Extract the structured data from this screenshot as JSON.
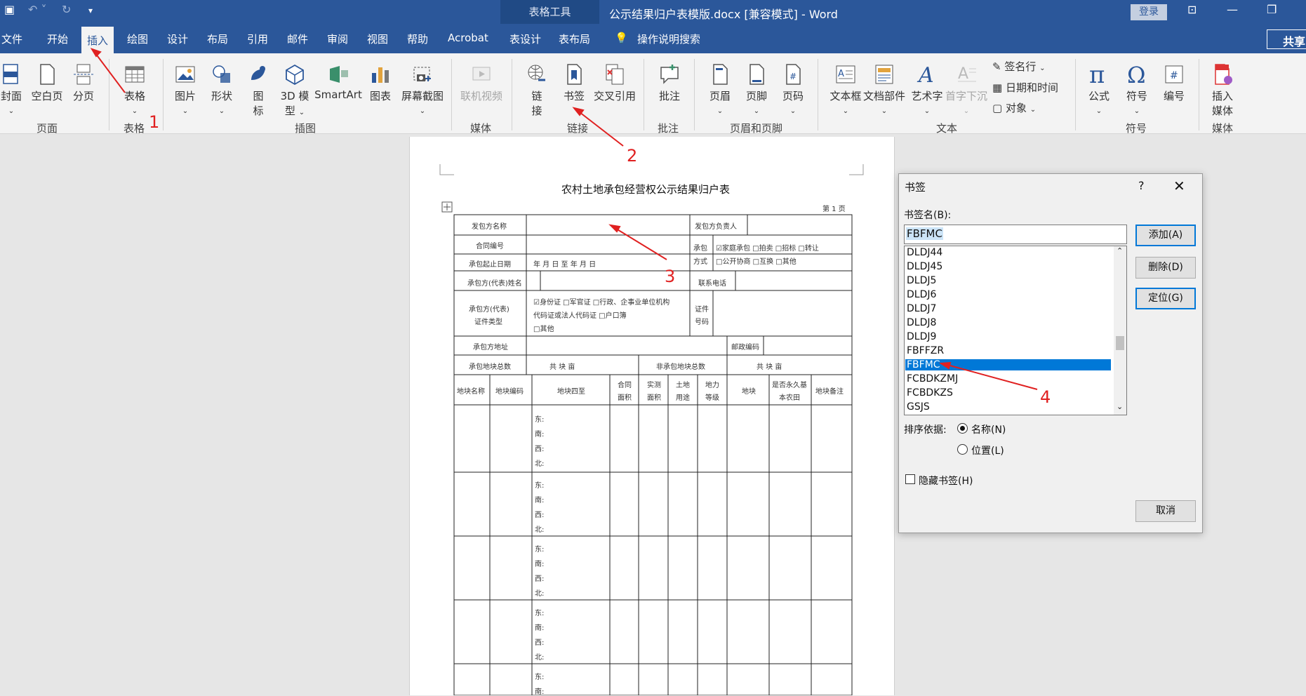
{
  "titlebar": {
    "context_label": "表格工具",
    "doc_title": "公示结果归户表模版.docx [兼容模式] - Word",
    "login": "登录"
  },
  "tabs": [
    "文件",
    "开始",
    "插入",
    "绘图",
    "设计",
    "布局",
    "引用",
    "邮件",
    "审阅",
    "视图",
    "帮助",
    "Acrobat",
    "表设计",
    "表布局"
  ],
  "active_tab": "插入",
  "tell_me": "操作说明搜索",
  "share": "共享",
  "ribbon": {
    "buttons": {
      "cover": "封面",
      "blank_page": "空白页",
      "page_break": "分页",
      "table": "表格",
      "pictures": "图片",
      "shapes": "形状",
      "icons_1": "图",
      "icons_2": "标",
      "model3d_1": "3D 模",
      "model3d_2": "型",
      "smartart": "SmartArt",
      "chart": "图表",
      "screenshot": "屏幕截图",
      "online_video": "联机视频",
      "link_1": "链",
      "link_2": "接",
      "bookmark": "书签",
      "cross_ref": "交叉引用",
      "comment": "批注",
      "header": "页眉",
      "footer": "页脚",
      "page_number": "页码",
      "text_box": "文本框",
      "quick_parts": "文档部件",
      "wordart": "艺术字",
      "drop_cap": "首字下沉",
      "signature_line": "签名行",
      "date_time": "日期和时间",
      "object": "对象",
      "equation": "公式",
      "symbol": "符号",
      "numbering": "编号",
      "insert_media_1": "插入",
      "insert_media_2": "媒体"
    },
    "groups": {
      "pages": "页面",
      "tables": "表格",
      "illustrations": "插图",
      "media": "媒体",
      "links": "链接",
      "comments": "批注",
      "header_footer": "页眉和页脚",
      "text": "文本",
      "symbols": "符号",
      "media2": "媒体"
    }
  },
  "document": {
    "title": "农村土地承包经营权公示结果归户表",
    "page_no": "第 1 页",
    "labels": {
      "fbf_name": "发包方名称",
      "fbf_head": "发包方负责人",
      "contract_no": "合同编号",
      "contract_mode_1": "承包",
      "contract_mode_2": "方式",
      "mode_opts_1": "☑家庭承包 □拍卖 □招标 □转让",
      "mode_opts_2": "□公开协商 □互换 □其他",
      "period": "承包起止日期",
      "period_value": "年    月    日 至      年    月    日",
      "cbf_name": "承包方(代表)姓名",
      "phone": "联系电话",
      "id_type_1": "承包方(代表)",
      "id_type_2": "证件类型",
      "id_opts_1": "☑身份证 □军官证 □行政、企事业单位机构",
      "id_opts_2": "代码证或法人代码证 □户口簿",
      "id_opts_3": "□其他",
      "id_no_1": "证件",
      "id_no_2": "号码",
      "address": "承包方地址",
      "postcode": "邮政编码",
      "total_plots": "承包地块总数",
      "total_value": "共    块    亩",
      "non_plots": "非承包地块总数",
      "non_value": "共    块    亩",
      "col_plot_name": "地块名称",
      "col_plot_code": "地块编码",
      "col_bounds": "地块四至",
      "col_contract_area_1": "合同",
      "col_contract_area_2": "面积",
      "col_real_area_1": "实测",
      "col_real_area_2": "面积",
      "col_land_use_1": "土地",
      "col_land_use_2": "用途",
      "col_grade_1": "地力",
      "col_grade_2": "等级",
      "col_type": "地块",
      "col_basic_1": "是否永久基",
      "col_basic_2": "本农田",
      "col_note": "地块备注",
      "dir_e": "东:",
      "dir_s": "南:",
      "dir_w": "西:",
      "dir_n": "北:",
      "mark": "↵"
    }
  },
  "dialog": {
    "title": "书签",
    "help": "?",
    "close": "✕",
    "name_label": "书签名(B):",
    "name_value": "FBFMC",
    "list": [
      "DLDJ44",
      "DLDJ45",
      "DLDJ5",
      "DLDJ6",
      "DLDJ7",
      "DLDJ8",
      "DLDJ9",
      "FBFFZR",
      "FBFMC",
      "FCBDKZMJ",
      "FCBDKZS",
      "GSJS"
    ],
    "selected": "FBFMC",
    "add": "添加(A)",
    "delete": "删除(D)",
    "goto": "定位(G)",
    "sort_label": "排序依据:",
    "sort_name": "名称(N)",
    "sort_position": "位置(L)",
    "hidden": "隐藏书签(H)",
    "cancel": "取消"
  },
  "annotations": [
    "1",
    "2",
    "3",
    "4"
  ]
}
